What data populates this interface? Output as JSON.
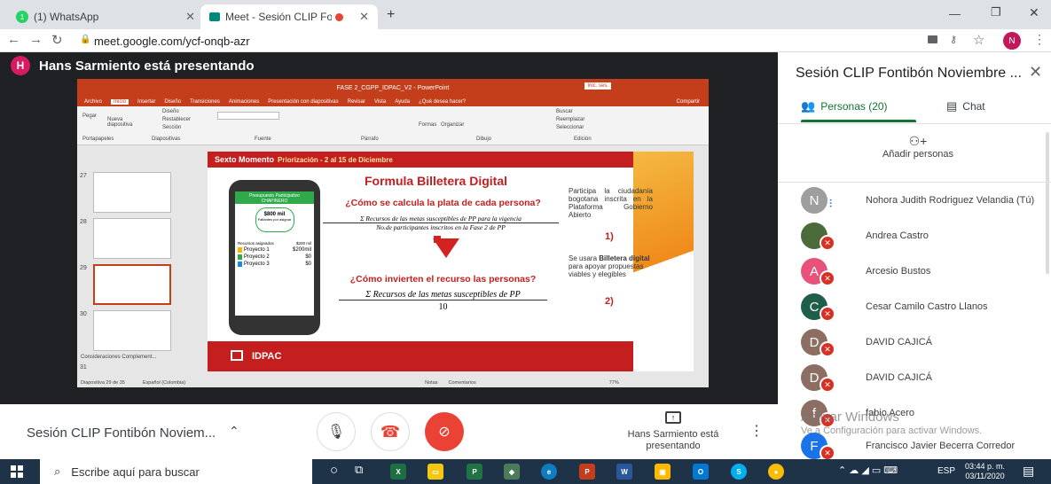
{
  "tabs": [
    {
      "title": "(1) WhatsApp",
      "badge": "1"
    },
    {
      "title": "Meet - Sesión CLIP Fontibón"
    }
  ],
  "url": "meet.google.com/ycf-onqb-azr",
  "profile": "N",
  "presenter_banner": "Hans Sarmiento está presentando",
  "presenter_initial": "H",
  "ppt": {
    "title": "FASE 2_CGPP_IDPAC_V2 - PowerPoint",
    "signin": "Inic. ses.",
    "menu": [
      "Archivo",
      "Inicio",
      "Insertar",
      "Diseño",
      "Transiciones",
      "Animaciones",
      "Presentación con diapositivas",
      "Revisar",
      "Vista",
      "Ayuda",
      "¿Qué desea hacer?"
    ],
    "share": "Compartir",
    "ribbon_groups": [
      "Portapapeles",
      "Diapositivas",
      "Fuente",
      "Párrafo",
      "Dibujo",
      "Edición"
    ],
    "ribbon_items": {
      "pegar": "Pegar",
      "nueva": "Nueva diapositiva",
      "diseno": "Diseño",
      "restablecer": "Restablecer",
      "seccion": "Sección",
      "formas": "Formas",
      "organizar": "Organizar",
      "buscar": "Buscar",
      "reemplazar": "Reemplazar",
      "seleccionar": "Seleccionar"
    },
    "thumb_numbers": [
      "27",
      "28",
      "29",
      "30",
      "31"
    ],
    "section": "Consideraciones Complement...",
    "status_left": "Diapositiva 29 de 35",
    "status_lang": "Español (Colombia)",
    "notes": "Notas",
    "comments": "Comentarios",
    "zoom": "77%"
  },
  "slide": {
    "band_title": "Sexto Momento",
    "band_sub": "Priorización - 2 al 15 de Diciembre",
    "heading": "Formula Billetera Digital",
    "q1": "¿Cómo se calcula la plata de cada persona?",
    "formula1_num": "Σ Recursos de las metas susceptibles de PP para la vigencia",
    "formula1_den": "No.de participantes inscritos en la Fase 2 de PP",
    "q2": "¿Cómo invierten el recurso las personas?",
    "formula2_num": "Σ Recursos de las metas susceptibles de PP",
    "formula2_den": "10",
    "note1": "Participa la ciudadanía bogotana inscrita en la Plataforma Gobierno Abierto",
    "note1_num": "1)",
    "note2_pre": "Se usara ",
    "note2_bold": "Billetera digital",
    "note2_post": " para apoyar propuestas viables y elegibles",
    "note2_num": "2)",
    "footer": "IDPAC",
    "phone": {
      "header": "Presupuesto Participativo CHAPINERO",
      "amount": "$800 mil",
      "amount_sub": "Faltantes por asignar",
      "assigned_label": "Recursos asignados",
      "assigned_value": "$200 mil",
      "projects": [
        {
          "name": "Proyecto 1",
          "value": "$200mil"
        },
        {
          "name": "Proyecto 2",
          "value": "$0"
        },
        {
          "name": "Proyecto 3",
          "value": "$0"
        }
      ]
    }
  },
  "meeting_name": "Sesión CLIP Fontibón Noviem...",
  "presenting_label": "Hans Sarmiento está presentando",
  "panel": {
    "title": "Sesión CLIP Fontibón Noviembre ...",
    "tab_people": "Personas (20)",
    "tab_chat": "Chat",
    "add_people": "Añadir personas",
    "people": [
      {
        "name": "Nohora Judith Rodriguez Velandia (Tú)",
        "initial": "N",
        "color": "#9e9e9e",
        "speaking": true
      },
      {
        "name": "Andrea Castro",
        "initial": "",
        "color": "#4b6b3a",
        "speaking": false
      },
      {
        "name": "Arcesio Bustos",
        "initial": "A",
        "color": "#e8527a",
        "speaking": false
      },
      {
        "name": "Cesar Camilo Castro Llanos",
        "initial": "C",
        "color": "#1e5e4a",
        "speaking": false
      },
      {
        "name": "DAVID CAJICÁ",
        "initial": "D",
        "color": "#8d6e63",
        "speaking": false
      },
      {
        "name": "DAVID CAJICÁ",
        "initial": "D",
        "color": "#8d6e63",
        "speaking": false
      },
      {
        "name": "fabio Acero",
        "initial": "f",
        "color": "#8d6e63",
        "speaking": false
      },
      {
        "name": "Francisco Javier Becerra Corredor",
        "initial": "F",
        "color": "#1a73e8",
        "speaking": false
      }
    ]
  },
  "watermark": {
    "line1": "Activar Windows",
    "line2": "Ve a Configuración para activar Windows."
  },
  "taskbar": {
    "search": "Escribe aquí para buscar",
    "lang": "ESP",
    "time": "03:44 p. m.",
    "date": "03/11/2020"
  },
  "colors": {
    "ppt_red": "#c43e1c",
    "slide_red": "#c41e1e",
    "meet_red": "#ea4335",
    "accent_green": "#137333"
  }
}
